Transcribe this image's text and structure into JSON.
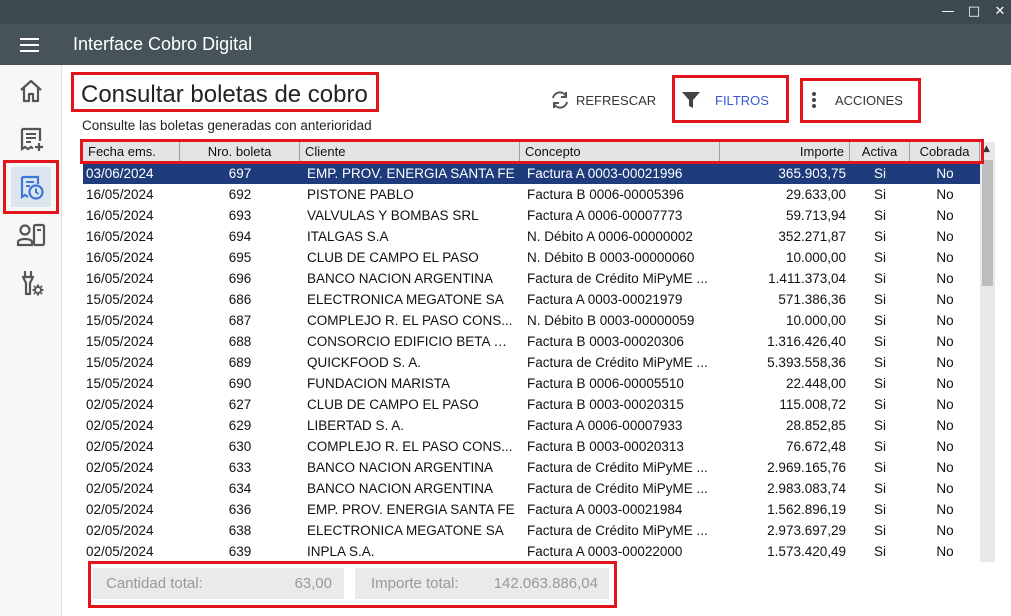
{
  "window": {
    "minimize": "—",
    "maximize": "□",
    "close": "✕"
  },
  "app": {
    "title": "Interface Cobro Digital"
  },
  "nav": {
    "items": [
      {
        "name": "home-icon"
      },
      {
        "name": "add-invoice-icon"
      },
      {
        "name": "invoice-history-icon",
        "active": true
      },
      {
        "name": "user-card-icon"
      },
      {
        "name": "tools-settings-icon"
      }
    ]
  },
  "page": {
    "title": "Consultar boletas de cobro",
    "subtitle": "Consulte las boletas generadas con anterioridad"
  },
  "toolbar": {
    "refresh_label": "REFRESCAR",
    "filters_label": "FILTROS",
    "actions_label": "ACCIONES"
  },
  "colors": {
    "accent": "#3a57d8",
    "selected_row": "#1e3c7c",
    "highlight": "#e3141b",
    "appbar": "#46545a"
  },
  "grid": {
    "columns": [
      "Fecha ems.",
      "Nro. boleta",
      "Cliente",
      "Concepto",
      "Importe",
      "Activa",
      "Cobrada"
    ],
    "sort_indicator": "▲",
    "rows": [
      [
        "03/06/2024",
        "697",
        "EMP. PROV. ENERGIA SANTA FE",
        "Factura A 0003-00021996",
        "365.903,75",
        "Si",
        "No"
      ],
      [
        "16/05/2024",
        "692",
        "PISTONE PABLO",
        "Factura B 0006-00005396",
        "29.633,00",
        "Si",
        "No"
      ],
      [
        "16/05/2024",
        "693",
        "VALVULAS Y BOMBAS SRL",
        "Factura A 0006-00007773",
        "59.713,94",
        "Si",
        "No"
      ],
      [
        "16/05/2024",
        "694",
        "ITALGAS S.A",
        "N. Débito A 0006-00000002",
        "352.271,87",
        "Si",
        "No"
      ],
      [
        "16/05/2024",
        "695",
        "CLUB DE CAMPO EL PASO",
        "N. Débito B 0003-00000060",
        "10.000,00",
        "Si",
        "No"
      ],
      [
        "16/05/2024",
        "696",
        "BANCO NACION ARGENTINA",
        "Factura de Crédito MiPyME ...",
        "1.411.373,04",
        "Si",
        "No"
      ],
      [
        "15/05/2024",
        "686",
        "ELECTRONICA MEGATONE SA",
        "Factura A 0003-00021979",
        "571.386,36",
        "Si",
        "No"
      ],
      [
        "15/05/2024",
        "687",
        "COMPLEJO R. EL PASO CONS...",
        "N. Débito B 0003-00000059",
        "10.000,00",
        "Si",
        "No"
      ],
      [
        "15/05/2024",
        "688",
        "CONSORCIO EDIFICIO BETA XXIII",
        "Factura B 0003-00020306",
        "1.316.426,40",
        "Si",
        "No"
      ],
      [
        "15/05/2024",
        "689",
        "QUICKFOOD S. A.",
        "Factura de Crédito MiPyME ...",
        "5.393.558,36",
        "Si",
        "No"
      ],
      [
        "15/05/2024",
        "690",
        "FUNDACION MARISTA",
        "Factura B 0006-00005510",
        "22.448,00",
        "Si",
        "No"
      ],
      [
        "02/05/2024",
        "627",
        "CLUB DE CAMPO EL PASO",
        "Factura B 0003-00020315",
        "115.008,72",
        "Si",
        "No"
      ],
      [
        "02/05/2024",
        "629",
        "LIBERTAD S. A.",
        "Factura A 0006-00007933",
        "28.852,85",
        "Si",
        "No"
      ],
      [
        "02/05/2024",
        "630",
        "COMPLEJO R. EL PASO CONS...",
        "Factura B 0003-00020313",
        "76.672,48",
        "Si",
        "No"
      ],
      [
        "02/05/2024",
        "633",
        "BANCO NACION ARGENTINA",
        "Factura de Crédito MiPyME ...",
        "2.969.165,76",
        "Si",
        "No"
      ],
      [
        "02/05/2024",
        "634",
        "BANCO NACION ARGENTINA",
        "Factura de Crédito MiPyME ...",
        "2.983.083,74",
        "Si",
        "No"
      ],
      [
        "02/05/2024",
        "636",
        "EMP. PROV. ENERGIA SANTA FE",
        "Factura A 0003-00021984",
        "1.562.896,19",
        "Si",
        "No"
      ],
      [
        "02/05/2024",
        "638",
        "ELECTRONICA MEGATONE SA",
        "Factura de Crédito MiPyME ...",
        "2.973.697,29",
        "Si",
        "No"
      ],
      [
        "02/05/2024",
        "639",
        "INPLA S.A.",
        "Factura A 0003-00022000",
        "1.573.420,49",
        "Si",
        "No"
      ]
    ],
    "selected_index": 0
  },
  "totals": {
    "count_label": "Cantidad total:",
    "count_value": "63,00",
    "amount_label": "Importe total:",
    "amount_value": "142.063.886,04"
  }
}
